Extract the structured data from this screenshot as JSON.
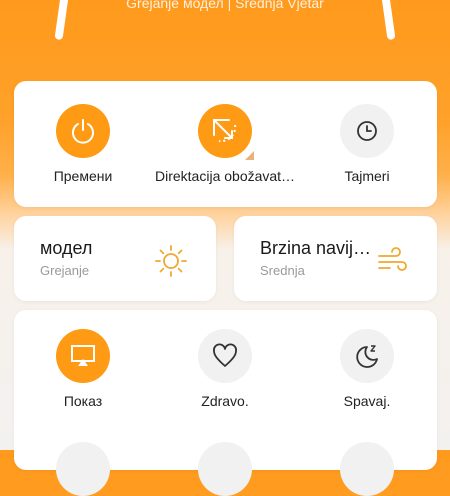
{
  "header": {
    "status_text": "Grejanje модел | Srednja Vjetar"
  },
  "controls": [
    {
      "id": "power",
      "label": "Премени",
      "icon": "power-icon",
      "active": true
    },
    {
      "id": "direction",
      "label": "Direktacija obožavat…",
      "icon": "fan-direction-icon",
      "active": true
    },
    {
      "id": "timer",
      "label": "Tajmeri",
      "icon": "clock-icon",
      "active": false
    }
  ],
  "mode_tile": {
    "title": "модел",
    "value": "Grejanje",
    "icon": "sun-icon"
  },
  "speed_tile": {
    "title": "Brzina navij…",
    "value": "Srednja",
    "icon": "wind-icon"
  },
  "features": [
    {
      "id": "display",
      "label": "Показ",
      "icon": "display-icon",
      "active": true
    },
    {
      "id": "health",
      "label": "Zdravo.",
      "icon": "heart-icon",
      "active": false
    },
    {
      "id": "sleep",
      "label": "Spavaj.",
      "icon": "moon-sleep-icon",
      "active": false
    }
  ],
  "colors": {
    "accent": "#ff9a14",
    "card": "#ffffff",
    "icon_gray": "#f1f1f1",
    "icon_yellow": "#f0a830"
  }
}
